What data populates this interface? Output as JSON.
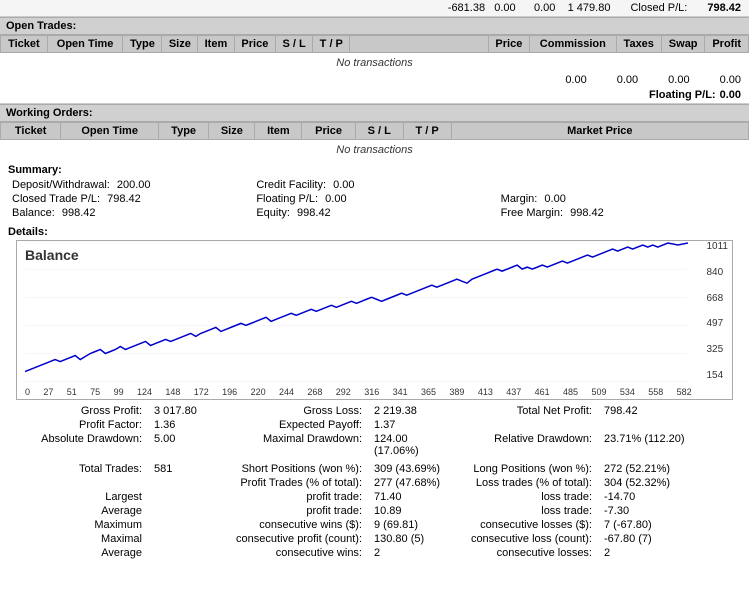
{
  "topbar": {
    "values": "-681.38   0.00      0.00    1 479.80",
    "closed_pl_label": "Closed P/L:",
    "closed_pl_value": "798.42"
  },
  "open_trades": {
    "title": "Open Trades:",
    "columns": [
      "Ticket",
      "Open Time",
      "Type",
      "Size",
      "Item",
      "Price",
      "S / L",
      "T / P",
      "",
      "Price",
      "Commission",
      "Taxes",
      "Swap",
      "Profit"
    ],
    "no_data": "No transactions",
    "subtotals": [
      "0.00",
      "0.00",
      "0.00",
      "0.00"
    ],
    "floating_pl_label": "Floating P/L:",
    "floating_pl_value": "0.00"
  },
  "working_orders": {
    "title": "Working Orders:",
    "columns": [
      "Ticket",
      "Open Time",
      "Type",
      "Size",
      "Item",
      "Price",
      "S / L",
      "T / P",
      "Market Price"
    ],
    "no_data": "No transactions"
  },
  "summary": {
    "title": "Summary:",
    "col1": [
      {
        "label": "Deposit/Withdrawal:",
        "value": "200.00"
      },
      {
        "label": "Closed Trade P/L:",
        "value": "798.42"
      },
      {
        "label": "Balance:",
        "value": "998.42"
      }
    ],
    "col2": [
      {
        "label": "Credit Facility:",
        "value": "0.00"
      },
      {
        "label": "Floating P/L:",
        "value": "0.00"
      },
      {
        "label": "Equity:",
        "value": "998.42"
      }
    ],
    "col3": [
      {
        "label": "Margin:",
        "value": "0.00"
      },
      {
        "label": "Free Margin:",
        "value": "998.42"
      }
    ]
  },
  "details": {
    "title": "Details:",
    "chart": {
      "label": "Balance",
      "y_labels": [
        "1011",
        "840",
        "668",
        "497",
        "325",
        "154"
      ],
      "x_labels": [
        "0",
        "27",
        "51",
        "75",
        "99",
        "124",
        "148",
        "172",
        "196",
        "220",
        "244",
        "268",
        "292",
        "316",
        "341",
        "365",
        "389",
        "413",
        "437",
        "461",
        "485",
        "509",
        "534",
        "558",
        "582"
      ]
    }
  },
  "stats": {
    "gross_profit_label": "Gross Profit:",
    "gross_profit_value": "3 017.80",
    "gross_loss_label": "Gross Loss:",
    "gross_loss_value": "2 219.38",
    "total_net_profit_label": "Total Net Profit:",
    "total_net_profit_value": "798.42",
    "profit_factor_label": "Profit Factor:",
    "profit_factor_value": "1.36",
    "expected_payoff_label": "Expected Payoff:",
    "expected_payoff_value": "1.37",
    "absolute_drawdown_label": "Absolute Drawdown:",
    "absolute_drawdown_value": "5.00",
    "maximal_drawdown_label": "Maximal Drawdown:",
    "maximal_drawdown_value": "124.00 (17.06%)",
    "relative_drawdown_label": "Relative Drawdown:",
    "relative_drawdown_value": "23.71% (112.20)",
    "total_trades_label": "Total Trades:",
    "total_trades_value": "581",
    "short_positions_label": "Short Positions (won %):",
    "short_positions_value": "309 (43.69%)",
    "long_positions_label": "Long Positions (won %):",
    "long_positions_value": "272 (52.21%)",
    "profit_trades_label": "Profit Trades (% of total):",
    "profit_trades_value": "277 (47.68%)",
    "loss_trades_label": "Loss trades (% of total):",
    "loss_trades_value": "304 (52.32%)",
    "largest_label": "Largest",
    "largest_profit_trade_label": "profit trade:",
    "largest_profit_trade_value": "71.40",
    "largest_loss_trade_label": "loss trade:",
    "largest_loss_trade_value": "-14.70",
    "average_label": "Average",
    "average_profit_trade_label": "profit trade:",
    "average_profit_trade_value": "10.89",
    "average_loss_trade_label": "loss trade:",
    "average_loss_trade_value": "-7.30",
    "maximum_label": "Maximum",
    "maximum_consec_wins_label": "consecutive wins ($):",
    "maximum_consec_wins_value": "9 (69.81)",
    "maximum_consec_losses_label": "consecutive losses ($):",
    "maximum_consec_losses_value": "7 (-67.80)",
    "maximal_label": "Maximal",
    "maximal_consec_profit_label": "consecutive profit (count):",
    "maximal_consec_profit_value": "130.80 (5)",
    "maximal_consec_loss_label": "consecutive loss (count):",
    "maximal_consec_loss_value": "-67.80 (7)",
    "average2_label": "Average",
    "average_consec_wins_label": "consecutive wins:",
    "average_consec_wins_value": "2",
    "average_consec_losses_label": "consecutive losses:",
    "average_consec_losses_value": "2"
  }
}
